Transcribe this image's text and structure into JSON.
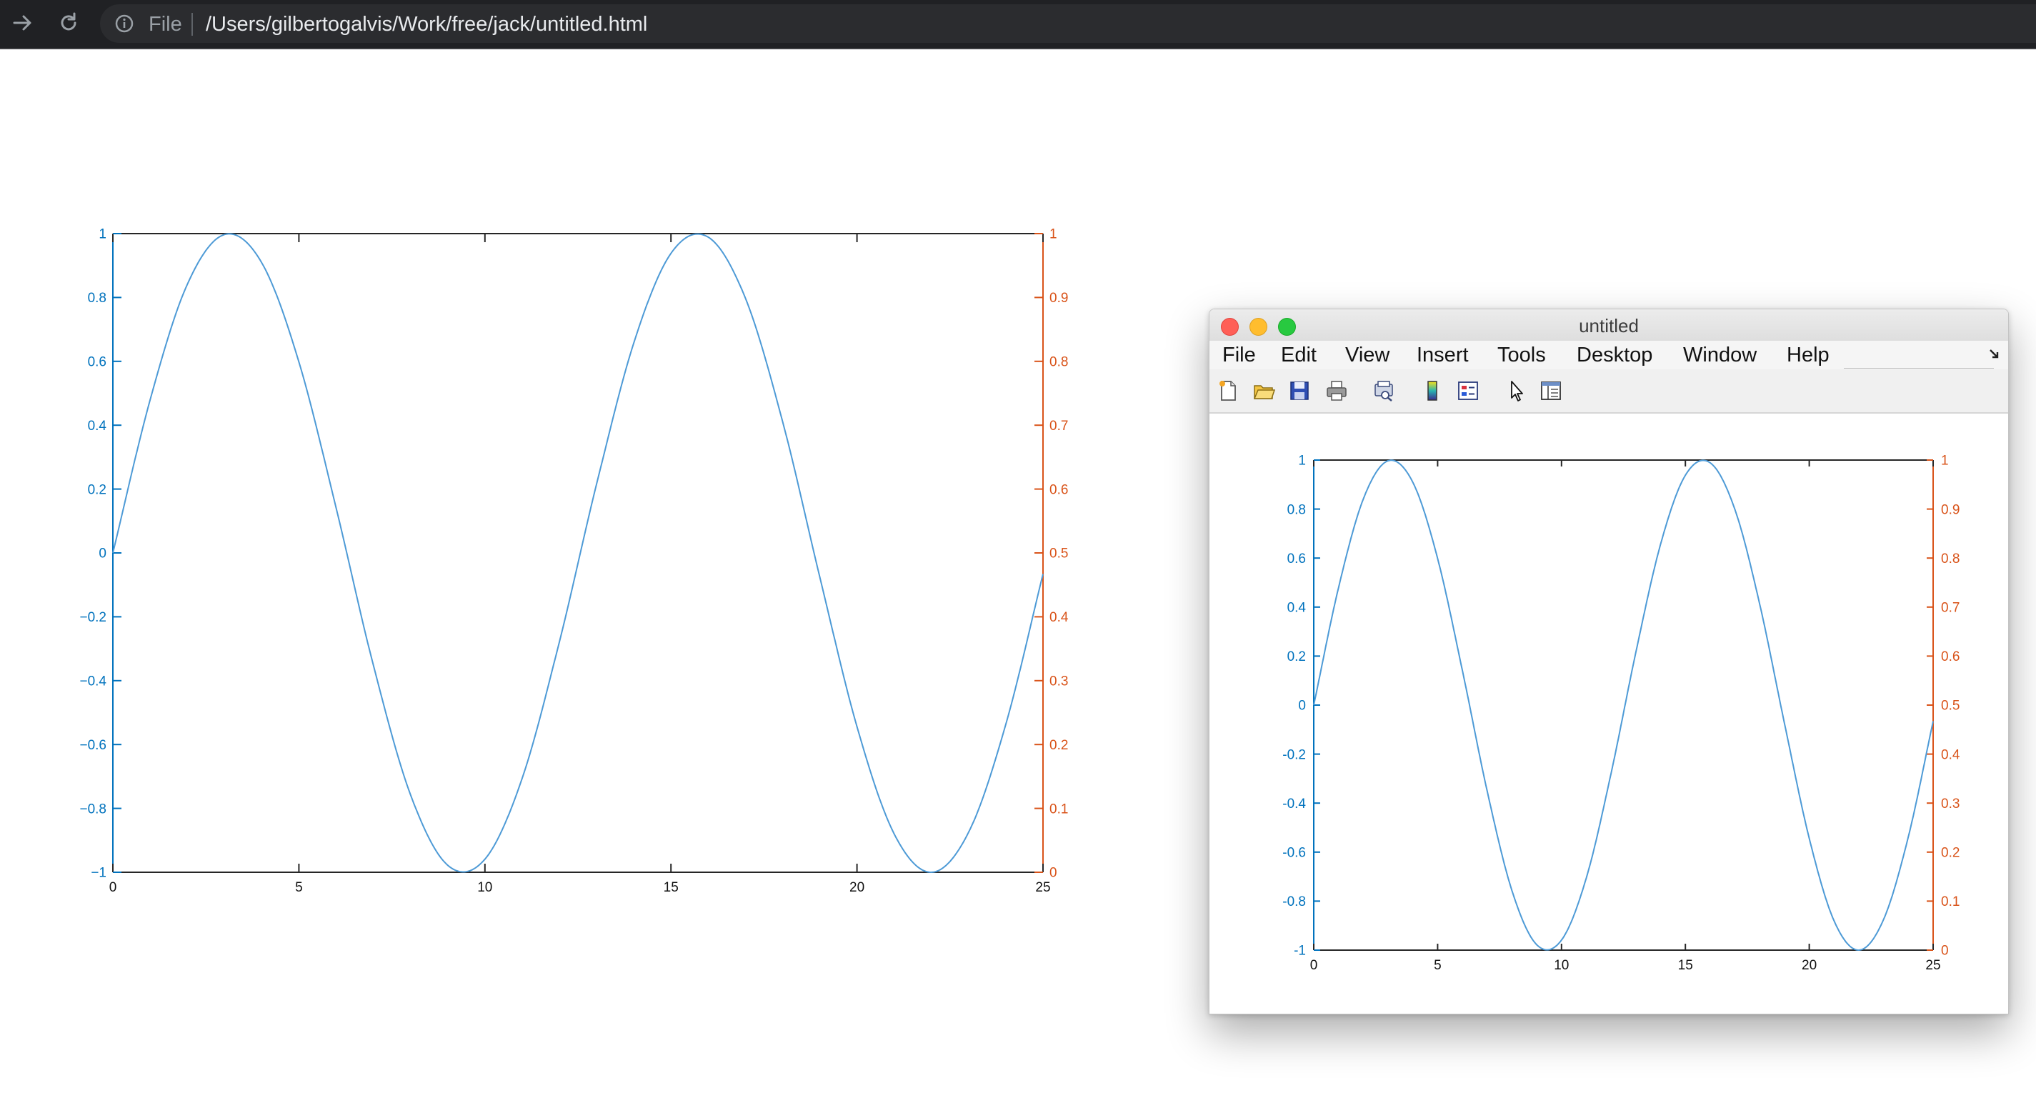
{
  "browser": {
    "scheme": "File",
    "url": "/Users/gilbertogalvis/Work/free/jack/untitled.html"
  },
  "figure_window": {
    "title": "untitled",
    "menu": [
      "File",
      "Edit",
      "View",
      "Insert",
      "Tools",
      "Desktop",
      "Window",
      "Help"
    ],
    "toolbar_icons": [
      "new-figure-icon",
      "open-file-icon",
      "save-icon",
      "print-icon",
      "print-preview-icon",
      "colorbar-icon",
      "legend-icon",
      "pointer-icon",
      "property-inspector-icon"
    ]
  },
  "colors": {
    "curve": "#4d9ad6",
    "left_axis": "#0072bd",
    "right_axis": "#d95319",
    "axis_black": "#262626"
  },
  "chart_data": [
    {
      "type": "line",
      "title": "",
      "xlabel": "",
      "ylabel": "",
      "xlim": [
        0,
        25
      ],
      "ylim": [
        -1,
        1
      ],
      "y2lim": [
        0,
        1
      ],
      "grid": false,
      "xticks": [
        "0",
        "5",
        "10",
        "15",
        "20",
        "25"
      ],
      "yticks": [
        "−1",
        "−0.8",
        "−0.6",
        "−0.4",
        "−0.2",
        "0",
        "0.2",
        "0.4",
        "0.6",
        "0.8",
        "1"
      ],
      "y2ticks": [
        "0",
        "0.1",
        "0.2",
        "0.3",
        "0.4",
        "0.5",
        "0.6",
        "0.7",
        "0.8",
        "0.9",
        "1"
      ],
      "series": [
        {
          "name": "",
          "x": [
            0,
            1,
            2,
            3,
            4,
            5,
            6,
            7,
            8,
            9,
            10,
            11,
            12,
            13,
            14,
            15,
            16,
            17,
            18,
            19,
            20,
            21,
            22,
            23,
            24,
            25
          ],
          "y": [
            0,
            0.479,
            0.841,
            0.997,
            0.909,
            0.598,
            0.141,
            -0.351,
            -0.757,
            -0.978,
            -0.959,
            -0.706,
            -0.279,
            0.215,
            0.657,
            0.938,
            0.989,
            0.798,
            0.412,
            -0.075,
            -0.544,
            -0.88,
            -1.0,
            -0.875,
            -0.537,
            -0.066
          ]
        }
      ]
    },
    {
      "type": "line",
      "title": "",
      "xlabel": "",
      "ylabel": "",
      "xlim": [
        0,
        25
      ],
      "ylim": [
        -1,
        1
      ],
      "y2lim": [
        0,
        1
      ],
      "grid": false,
      "xticks": [
        "0",
        "5",
        "10",
        "15",
        "20",
        "25"
      ],
      "yticks": [
        "-1",
        "-0.8",
        "-0.6",
        "-0.4",
        "-0.2",
        "0",
        "0.2",
        "0.4",
        "0.6",
        "0.8",
        "1"
      ],
      "y2ticks": [
        "0",
        "0.1",
        "0.2",
        "0.3",
        "0.4",
        "0.5",
        "0.6",
        "0.7",
        "0.8",
        "0.9",
        "1"
      ],
      "series": [
        {
          "name": "",
          "x": [
            0,
            1,
            2,
            3,
            4,
            5,
            6,
            7,
            8,
            9,
            10,
            11,
            12,
            13,
            14,
            15,
            16,
            17,
            18,
            19,
            20,
            21,
            22,
            23,
            24,
            25
          ],
          "y": [
            0,
            0.479,
            0.841,
            0.997,
            0.909,
            0.598,
            0.141,
            -0.351,
            -0.757,
            -0.978,
            -0.959,
            -0.706,
            -0.279,
            0.215,
            0.657,
            0.938,
            0.989,
            0.798,
            0.412,
            -0.075,
            -0.544,
            -0.88,
            -1.0,
            -0.875,
            -0.537,
            -0.066
          ]
        }
      ]
    }
  ]
}
